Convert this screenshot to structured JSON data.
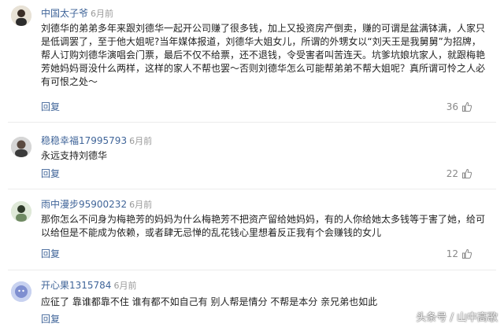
{
  "comments": [
    {
      "username": "中国太子爷",
      "time": "6月前",
      "text": "刘德华的弟弟多年来跟刘德华一起开公司赚了很多钱，加上又投资房产倒卖，赚的可谓是盆满钵满，人家只是低调罢了，至于他大姐呢?当年媒体报道，刘德华大姐女儿，所谓的外甥女以“刘天王是我舅舅”为招牌，帮人订购刘德华演唱会门票，最后不仅不给票，还不退钱，令受害者叫苦连天。坑爹坑娘坑家人，就跟梅艳芳她妈妈哥没什么两样，这样的家人不帮也罢～否则刘德华怎么可能帮弟弟不帮大姐呢？真所谓可怜之人必有可恨之处～",
      "reply_label": "回复",
      "likes": "36"
    },
    {
      "username": "稳稳幸福17995793",
      "time": "6月前",
      "text": "永远支持刘德华",
      "reply_label": "回复",
      "likes": "22"
    },
    {
      "username": "雨中漫步95900232",
      "time": "6月前",
      "text": "那你怎么不问身为梅艳芳的妈妈为什么梅艳芳不把资产留给她妈妈，有的人你给她太多钱等于害了她，给可以给但是不能成为依赖，或者肆无忌惮的乱花钱心里想着反正我有个会赚钱的女儿",
      "reply_label": "回复",
      "likes": "12"
    },
    {
      "username": "开心果1315784",
      "time": "6月前",
      "text": "应征了 靠谁都靠不住 谁有都不如自己有 别人帮是情分 不帮是本分 亲兄弟也如此",
      "reply_label": "回复",
      "likes": ""
    }
  ],
  "watermark": "头条号 / 山中高歌",
  "colors": {
    "username": "#406599",
    "time": "#999999",
    "text": "#222222"
  },
  "icons": {
    "like": "thumbs-up-icon"
  }
}
